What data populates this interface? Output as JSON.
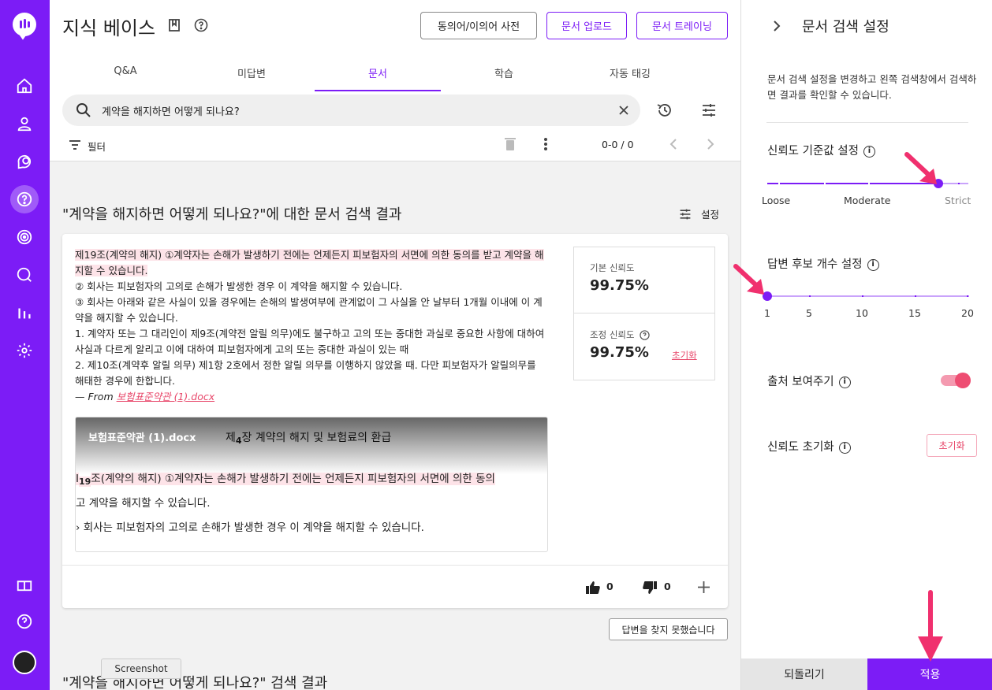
{
  "header": {
    "title": "지식 베이스",
    "synonym_dict_label": "동의어/이의어 사전",
    "upload_label": "문서 업로드",
    "training_label": "문서 트레이닝"
  },
  "tabs": [
    {
      "label": "Q&A"
    },
    {
      "label": "미답변"
    },
    {
      "label": "문서"
    },
    {
      "label": "학습"
    },
    {
      "label": "자동 태깅"
    }
  ],
  "active_tab": "문서",
  "search": {
    "value": "계약을 해지하면 어떻게 되나요?"
  },
  "toolbar": {
    "filter_label": "필터",
    "page_count": "0-0 / 0"
  },
  "result": {
    "title": "\"계약을 해지하면 어떻게 되나요?\"에 대한 문서 검색 결과",
    "settings_label": "설정",
    "highlight_text": "제19조(계약의 해지) ①계약자는 손해가 발생하기 전에는 언제든지 피보험자의 서면에 의한 동의를 받고 계약을 해지할 수 있습니다.",
    "body_lines": [
      "② 회사는 피보험자의 고의로 손해가 발생한 경우 이 계약을 해지할 수 있습니다.",
      "③ 회사는 아래와 같은 사실이 있을 경우에는 손해의 발생여부에 관계없이 그 사실을 안 날부터 1개월 이내에 이 계약을 해지할 수 있습니다.",
      "1. 계약자 또는 그 대리인이 제9조(계약전 알릴 의무)에도 불구하고 고의 또는 중대한 과실로 중요한 사항에 대하여 사실과 다르게 알리고 이에 대하여 피보험자에게 고의 또는 중대한 과실이 있는 때",
      "2. 제10조(계약후 알릴 의무) 제1항 2호에서 정한 알릴 의무를 이행하지 않았을 때. 다만 피보험자가 알릴의무를 해태한 경우에 한합니다."
    ],
    "source_prefix": "— From ",
    "source_file": "보험표준약관 (1).docx",
    "preview": {
      "file_name": "보험표준약관 (1).docx",
      "chapter_pre": "제",
      "chapter_num": "4",
      "chapter_post": "장 계약의 해지 및 보험료의 환급",
      "line1_pre": "I",
      "line1_num": "19",
      "line1_post": "조(계약의 해지) ①계약자는 손해가 발생하기 전에는 언제든지 피보험자의 서면에 의한 동의",
      "line2": "고 계약을 해지할 수 있습니다.",
      "line3": "› 회사는 피보험자의 고의로 손해가 발생한 경우 이 계약을 해지할 수 있습니다."
    },
    "base_conf_label": "기본 신뢰도",
    "base_conf_value": "99.75%",
    "adj_conf_label": "조정 신뢰도",
    "adj_conf_value": "99.75%",
    "reset_label": "초기화",
    "likes": "0",
    "dislikes": "0"
  },
  "not_found_label": "답변을 찾지 못했습니다",
  "tooltip_label": "Screenshot",
  "result2_title": "\"계약을 해지하면 어떻게 되나요?\" 검색 결과",
  "panel": {
    "title": "문서 검색 설정",
    "description": "문서 검색 설정을 변경하고 왼쪽 검색창에서 검색하면 결과를 확인할 수 있습니다.",
    "threshold_label": "신뢰도 기준값 설정",
    "threshold_labels": [
      "Loose",
      "Moderate",
      "Strict"
    ],
    "threshold_value": "Strict",
    "candidates_label": "답변 후보 개수 설정",
    "candidate_ticks": [
      "1",
      "5",
      "10",
      "15",
      "20"
    ],
    "candidate_value": 1,
    "show_source_label": "출처 보여주기",
    "show_source_on": true,
    "reset_conf_label": "신뢰도 초기화",
    "reset_button": "초기화",
    "revert_label": "되돌리기",
    "apply_label": "적용"
  },
  "colors": {
    "accent": "#7c1cf6",
    "pink": "#e8476a",
    "annotation_arrow": "#f0306e"
  }
}
